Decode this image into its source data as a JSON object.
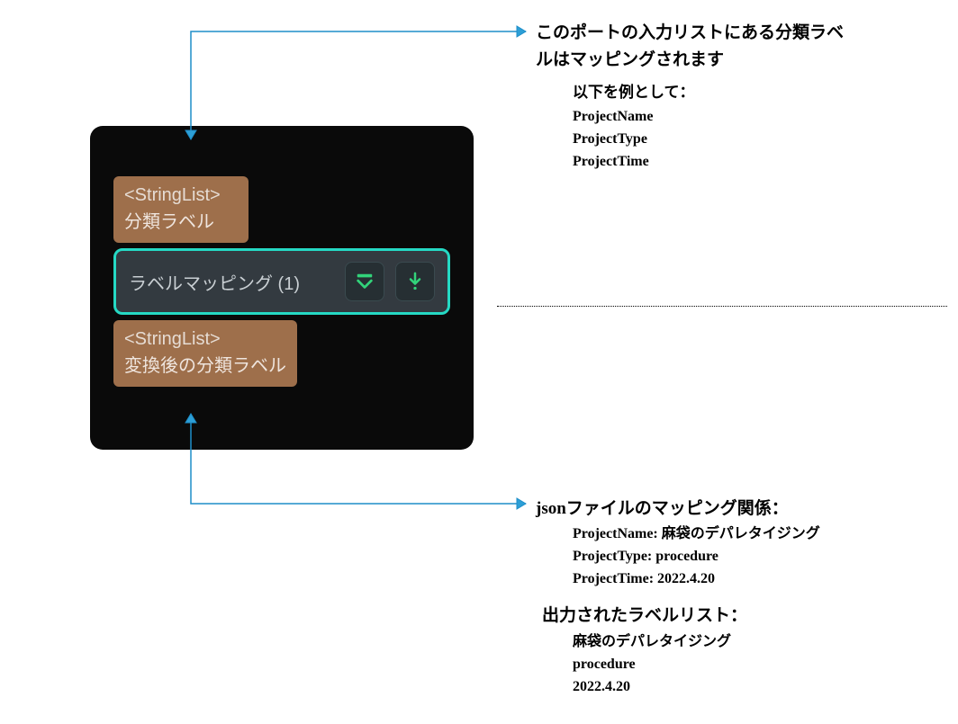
{
  "node": {
    "input_port": {
      "type": "<StringList>",
      "label": "分類ラベル"
    },
    "mapping": {
      "label": "ラベルマッピング (1)"
    },
    "output_port": {
      "type": "<StringList>",
      "label": "変換後の分類ラベル"
    }
  },
  "callout_top": {
    "heading_l1": "このポートの入力リストにある分類ラベ",
    "heading_l2": "ルはマッピングされます",
    "subheading": "以下を例として：",
    "items": [
      "ProjectName",
      "ProjectType",
      "ProjectTime"
    ]
  },
  "callout_bottom": {
    "json_heading": "jsonファイルのマッピング関係：",
    "json_lines": [
      "ProjectName: 麻袋のデパレタイジング",
      "ProjectType: procedure",
      "ProjectTime: 2022.4.20"
    ],
    "output_heading": "出力されたラベルリスト：",
    "output_lines": [
      "麻袋のデパレタイジング",
      "procedure",
      "2022.4.20"
    ]
  }
}
